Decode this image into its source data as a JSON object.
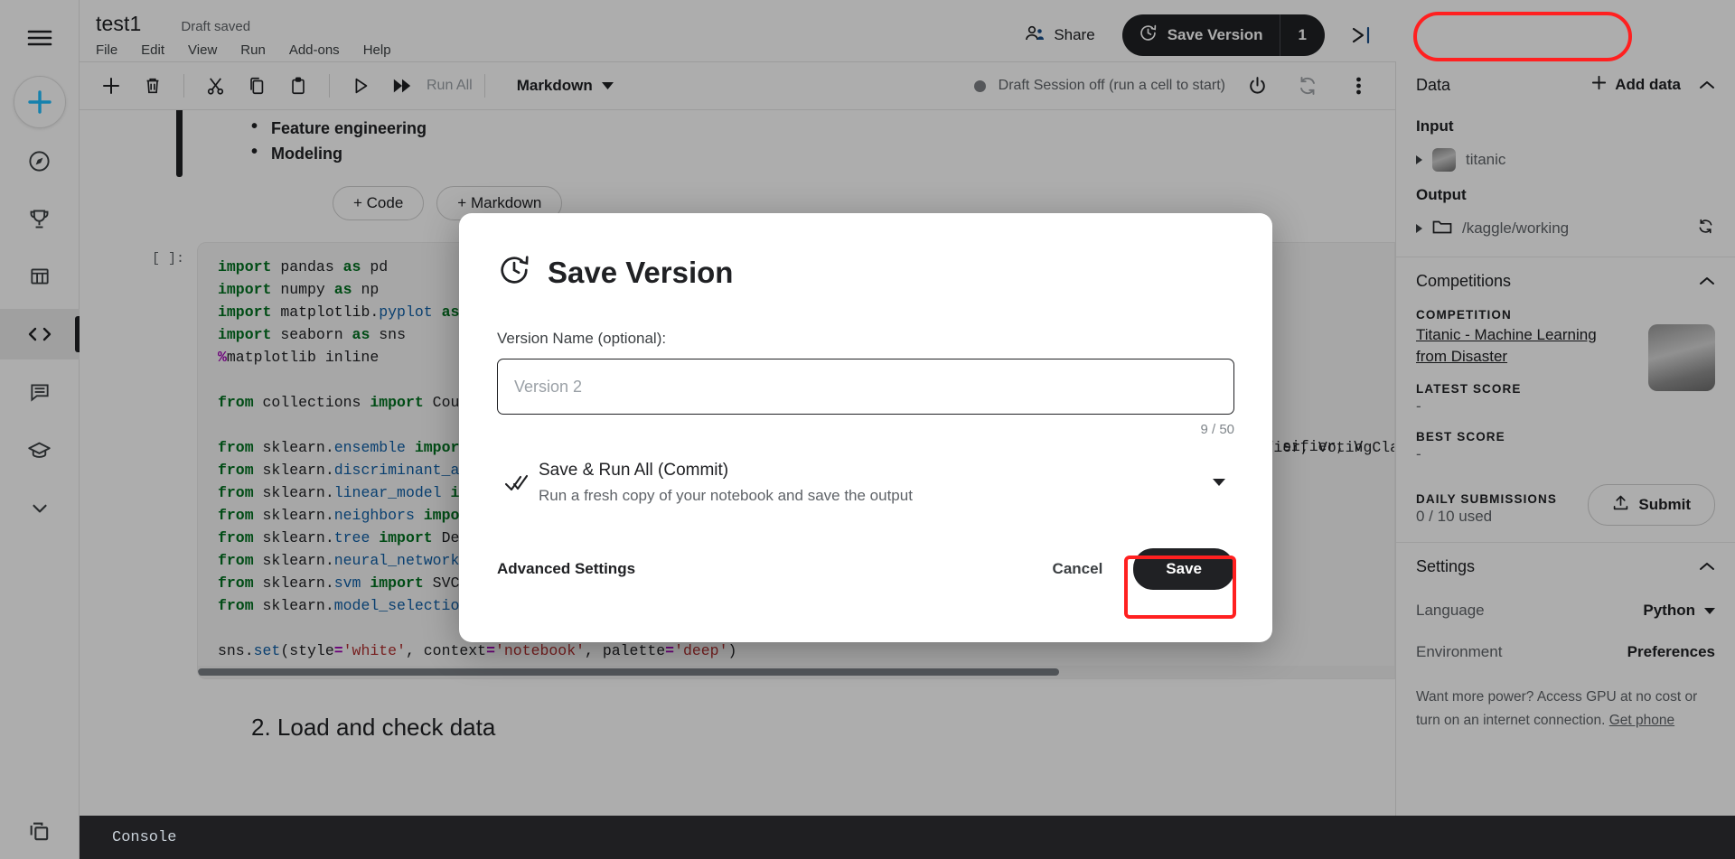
{
  "app": {
    "notebook_title": "test1",
    "draft_status": "Draft saved",
    "menu": [
      "File",
      "Edit",
      "View",
      "Run",
      "Add-ons",
      "Help"
    ],
    "share_label": "Share",
    "save_version_label": "Save Version",
    "save_version_count": "1",
    "collapse_icon": "collapse-right-icon"
  },
  "toolbar": {
    "icons": [
      "add-cell-icon",
      "delete-cell-icon",
      "cut-icon",
      "copy-icon",
      "paste-icon",
      "run-cell-icon",
      "run-all-icon"
    ],
    "run_all_label": "Run All",
    "cell_type": "Markdown",
    "session_status": "Draft Session off (run a cell to start)",
    "power_icon": "power-icon",
    "restart_icon": "restart-icon",
    "more_icon": "more-vertical-icon"
  },
  "notebook": {
    "markdown_items": [
      "Feature engineering",
      "Modeling"
    ],
    "add_code_label": "+ Code",
    "add_markdown_label": "+ Markdown",
    "cell_prompt": "[ ]:",
    "section_heading": "2. Load and check data",
    "console_label": "Console",
    "code_right_fragment": "sifier, V"
  },
  "sidebar": {
    "data": {
      "title": "Data",
      "add_data_label": "Add data",
      "input_heading": "Input",
      "input_item": "titanic",
      "output_heading": "Output",
      "output_item": "/kaggle/working"
    },
    "competitions": {
      "title": "Competitions",
      "competition_caption": "COMPETITION",
      "competition_name": "Titanic - Machine Learning from Disaster",
      "latest_score_caption": "LATEST SCORE",
      "latest_score_value": "-",
      "best_score_caption": "BEST SCORE",
      "best_score_value": "-",
      "daily_submissions_caption": "DAILY SUBMISSIONS",
      "daily_submissions_value": "0 / 10 used",
      "submit_label": "Submit"
    },
    "settings": {
      "title": "Settings",
      "language_label": "Language",
      "language_value": "Python",
      "environment_label": "Environment",
      "environment_value": "Preferences",
      "note_text": "Want more power? Access GPU at no cost or turn on an internet connection. ",
      "note_link": "Get phone"
    }
  },
  "modal": {
    "title": "Save Version",
    "title_icon": "history-clock-icon",
    "field_label": "Version Name (optional):",
    "input_value": "",
    "input_placeholder": "Version 2",
    "counter": "9 / 50",
    "option_title": "Save & Run All (Commit)",
    "option_desc": "Run a fresh copy of your notebook and save the output",
    "option_icon": "double-check-icon",
    "advanced_label": "Advanced Settings",
    "cancel_label": "Cancel",
    "save_label": "Save"
  },
  "colors": {
    "accent": "#202124",
    "highlight": "#ff2020",
    "link_blue": "#20beff"
  }
}
